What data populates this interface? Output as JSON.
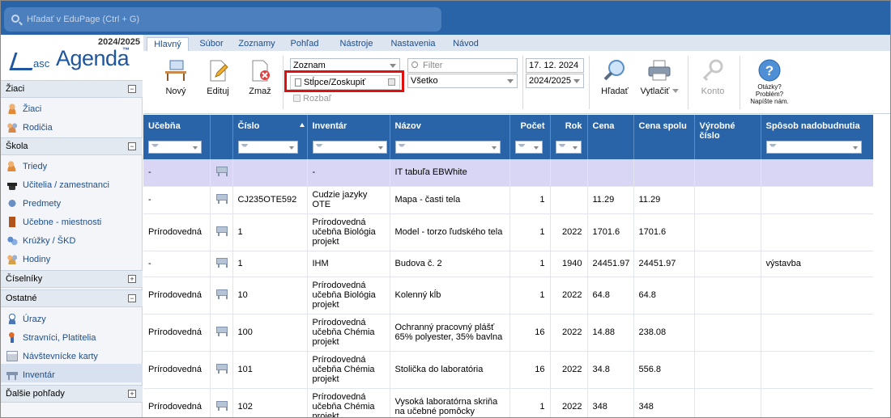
{
  "search": {
    "placeholder": "Hľadať v EduPage (Ctrl + G)"
  },
  "logo": {
    "year": "2024/2025",
    "asc": "asc",
    "agenda": "Agenda",
    "tm": "™"
  },
  "sidebar": {
    "sections": [
      {
        "label": "Žiaci",
        "toggle": "−",
        "items": [
          "Žiaci",
          "Rodičia"
        ]
      },
      {
        "label": "Škola",
        "toggle": "−",
        "items": [
          "Triedy",
          "Učitelia / zamestnanci",
          "Predmety",
          "Učebne - miestnosti",
          "Krúžky / ŠKD",
          "Hodiny"
        ]
      },
      {
        "label": "Číselníky",
        "toggle": "+",
        "items": []
      },
      {
        "label": "Ostatné",
        "toggle": "−",
        "items": [
          "Úrazy",
          "Stravníci, Platitelia",
          "Návštevnícke karty",
          "Inventár"
        ]
      },
      {
        "label": "Ďalšie pohľady",
        "toggle": "+",
        "items": []
      }
    ]
  },
  "tabs": [
    "Hlavný",
    "Súbor",
    "Zoznamy",
    "Pohľad",
    "Nástroje",
    "Nastavenia",
    "Návod"
  ],
  "ribbon": {
    "new": "Nový",
    "edit": "Edituj",
    "delete": "Zmaž",
    "view_select": "Zoznam",
    "columns_group": "Stĺpce/Zoskupiť",
    "expand": "Rozbaľ",
    "filter_placeholder": "Filter",
    "filter_select": "Všetko",
    "date": "17. 12. 2024",
    "school_year": "2024/2025",
    "find": "Hľadať",
    "print": "Vytlačiť",
    "account": "Konto",
    "help_line1": "Otázky?",
    "help_line2": "Problém?",
    "help_line3": "Napíšte nám."
  },
  "table": {
    "headers": [
      "Učebňa",
      "",
      "Číslo",
      "Inventár",
      "Názov",
      "Počet",
      "Rok",
      "Cena",
      "Cena spolu",
      "Výrobné číslo",
      "Spôsob nadobudnutia"
    ],
    "rows": [
      {
        "ucebna": "-",
        "cislo": "",
        "inventar": "-",
        "nazov": "IT tabuľa EBWhite",
        "pocet": "",
        "rok": "",
        "cena": "",
        "spolu": "",
        "vyrobne": "",
        "sposob": ""
      },
      {
        "ucebna": "-",
        "cislo": "CJ235OTE592",
        "inventar": "Cudzie jazyky OTE",
        "nazov": "Mapa - časti tela",
        "pocet": "1",
        "rok": "",
        "cena": "11.29",
        "spolu": "11.29",
        "vyrobne": "",
        "sposob": ""
      },
      {
        "ucebna": "Prírodovedná",
        "cislo": "1",
        "inventar": "Prírodovedná učebňa Biológia projekt",
        "nazov": "Model - torzo ľudského tela",
        "pocet": "1",
        "rok": "2022",
        "cena": "1701.6",
        "spolu": "1701.6",
        "vyrobne": "",
        "sposob": ""
      },
      {
        "ucebna": "-",
        "cislo": "1",
        "inventar": "IHM",
        "nazov": "Budova č. 2",
        "pocet": "1",
        "rok": "1940",
        "cena": "24451.97",
        "spolu": "24451.97",
        "vyrobne": "",
        "sposob": "výstavba"
      },
      {
        "ucebna": "Prírodovedná",
        "cislo": "10",
        "inventar": "Prírodovedná učebňa Biológia projekt",
        "nazov": "Kolenný kĺb",
        "pocet": "1",
        "rok": "2022",
        "cena": "64.8",
        "spolu": "64.8",
        "vyrobne": "",
        "sposob": ""
      },
      {
        "ucebna": "Prírodovedná",
        "cislo": "100",
        "inventar": "Prírodovedná učebňa Chémia projekt",
        "nazov": "Ochranný pracovný plášť 65% polyester, 35% bavlna",
        "pocet": "16",
        "rok": "2022",
        "cena": "14.88",
        "spolu": "238.08",
        "vyrobne": "",
        "sposob": ""
      },
      {
        "ucebna": "Prírodovedná",
        "cislo": "101",
        "inventar": "Prírodovedná učebňa Chémia projekt",
        "nazov": "Stolička do laboratória",
        "pocet": "16",
        "rok": "2022",
        "cena": "34.8",
        "spolu": "556.8",
        "vyrobne": "",
        "sposob": ""
      },
      {
        "ucebna": "Prírodovedná",
        "cislo": "102",
        "inventar": "Prírodovedná učebňa Chémia projekt",
        "nazov": "Vysoká laboratórna skriňa na učebné pomôcky",
        "pocet": "1",
        "rok": "2022",
        "cena": "348",
        "spolu": "348",
        "vyrobne": "",
        "sposob": ""
      }
    ]
  },
  "colors": {
    "topbar": "#2a64a8",
    "header": "#2a64a8",
    "selected_row": "#d9d6f5",
    "highlight": "#e01010",
    "link": "#1d4e8c"
  }
}
